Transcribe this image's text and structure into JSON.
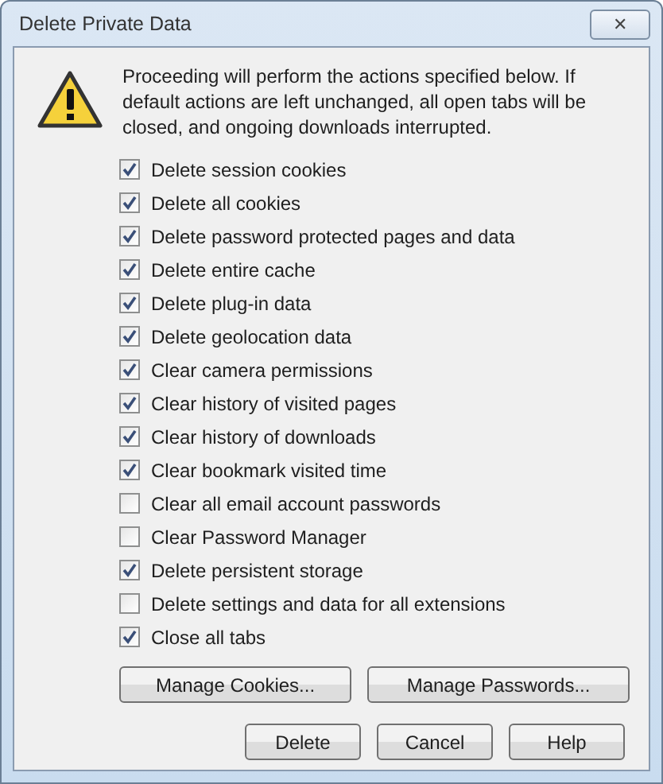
{
  "window": {
    "title": "Delete Private Data",
    "close": "✕"
  },
  "message": "Proceeding will perform the actions specified below. If default actions are left unchanged, all open tabs will be closed, and ongoing downloads interrupted.",
  "options": [
    {
      "label": "Delete session cookies",
      "checked": true
    },
    {
      "label": "Delete all cookies",
      "checked": true
    },
    {
      "label": "Delete password protected pages and data",
      "checked": true
    },
    {
      "label": "Delete entire cache",
      "checked": true
    },
    {
      "label": "Delete plug-in data",
      "checked": true
    },
    {
      "label": "Delete geolocation data",
      "checked": true
    },
    {
      "label": "Clear camera permissions",
      "checked": true
    },
    {
      "label": "Clear history of visited pages",
      "checked": true
    },
    {
      "label": "Clear history of downloads",
      "checked": true
    },
    {
      "label": "Clear bookmark visited time",
      "checked": true
    },
    {
      "label": "Clear all email account passwords",
      "checked": false
    },
    {
      "label": "Clear Password Manager",
      "checked": false
    },
    {
      "label": "Delete persistent storage",
      "checked": true
    },
    {
      "label": "Delete settings and data for all extensions",
      "checked": false
    },
    {
      "label": "Close all tabs",
      "checked": true
    }
  ],
  "manage_buttons": [
    "Manage Cookies...",
    "Manage Passwords..."
  ],
  "buttons": [
    "Delete",
    "Cancel",
    "Help"
  ]
}
